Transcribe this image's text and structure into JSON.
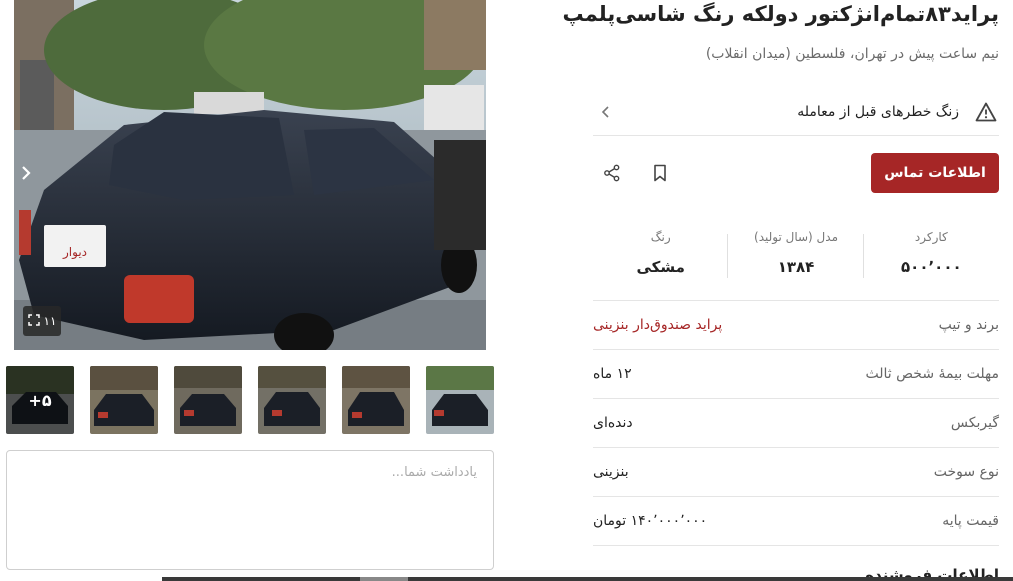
{
  "listing": {
    "title": "پراید۸۳تمام‌انژکتور دولکه رنگ شاسی‌پلمپ",
    "subtitle": "نیم ساعت پیش در تهران، فلسطین (میدان انقلاب)"
  },
  "warning": {
    "text": "زنگ خطرهای قبل از معامله"
  },
  "actions": {
    "contact_label": "اطلاعات تماس"
  },
  "stats": [
    {
      "label": "کارکرد",
      "value": "۵۰۰٬۰۰۰"
    },
    {
      "label": "مدل (سال تولید)",
      "value": "۱۳۸۴"
    },
    {
      "label": "رنگ",
      "value": "مشکی"
    }
  ],
  "details": [
    {
      "label": "برند و تیپ",
      "value": "پراید صندوق‌دار بنزینی"
    },
    {
      "label": "مهلت بیمهٔ شخص ثالث",
      "value": "۱۲ ماه"
    },
    {
      "label": "گیربکس",
      "value": "دنده‌ای"
    },
    {
      "label": "نوع سوخت",
      "value": "بنزینی"
    },
    {
      "label": "قیمت پایه",
      "value": "۱۴۰٬۰۰۰٬۰۰۰ تومان"
    }
  ],
  "next_section": {
    "title": "اطلاعات فروشنده"
  },
  "gallery": {
    "photo_count": "۱۱",
    "more_label": "+۵",
    "plate_text": "دیوار"
  },
  "notes": {
    "placeholder": "یادداشت شما..."
  },
  "colors": {
    "accent": "#a62626",
    "car": "#1b1f27"
  }
}
